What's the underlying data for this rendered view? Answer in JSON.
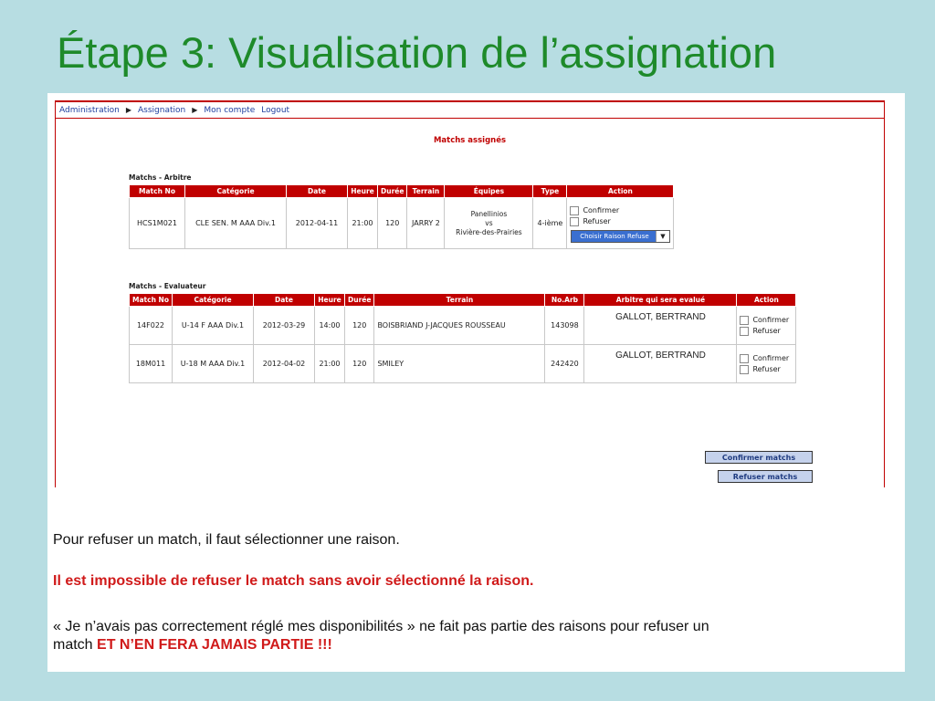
{
  "slide": {
    "title": "Étape 3: Visualisation de l’assignation"
  },
  "nav": {
    "items": [
      "Administration",
      "Assignation",
      "Mon compte",
      "Logout"
    ]
  },
  "section_header": "Matchs assignés",
  "arbitre_table": {
    "caption": "Matchs - Arbitre",
    "headers": [
      "Match No",
      "Catégorie",
      "Date",
      "Heure",
      "Durée",
      "Terrain",
      "Équipes",
      "Type",
      "Action"
    ],
    "rows": [
      {
        "match_no": "HCS1M021",
        "categorie": "CLE SEN. M AAA Div.1",
        "date": "2012-04-11",
        "heure": "21:00",
        "duree": "120",
        "terrain": "JARRY 2",
        "equipe1": "Panellinios",
        "vs": "vs",
        "equipe2": "Rivière-des-Prairies",
        "type": "4-ième",
        "confirmer": "Confirmer",
        "refuser": "Refuser",
        "raison_select": "Choisir Raison Refuse"
      }
    ]
  },
  "evaluateur_table": {
    "caption": "Matchs - Evaluateur",
    "headers": [
      "Match No",
      "Catégorie",
      "Date",
      "Heure",
      "Durée",
      "Terrain",
      "No.Arb",
      "Arbitre qui sera evalué",
      "Action"
    ],
    "rows": [
      {
        "match_no": "14F022",
        "categorie": "U-14 F AAA Div.1",
        "date": "2012-03-29",
        "heure": "14:00",
        "duree": "120",
        "terrain": "BOISBRIAND J-JACQUES ROUSSEAU",
        "no_arb": "143098",
        "arbitre": "GALLOT, BERTRAND",
        "confirmer": "Confirmer",
        "refuser": "Refuser"
      },
      {
        "match_no": "18M011",
        "categorie": "U-18 M AAA Div.1",
        "date": "2012-04-02",
        "heure": "21:00",
        "duree": "120",
        "terrain": "SMILEY",
        "no_arb": "242420",
        "arbitre": "GALLOT, BERTRAND",
        "confirmer": "Confirmer",
        "refuser": "Refuser"
      }
    ]
  },
  "buttons": {
    "confirm": "Confirmer matchs",
    "refuse": "Refuser matchs"
  },
  "notes": {
    "line1": "Pour refuser un match, il faut sélectionner une raison.",
    "line2": "Il est impossible de refuser le match sans avoir sélectionné la raison.",
    "line3a": "« Je n’avais pas correctement réglé mes disponibilités » ne fait pas partie des raisons pour refuser un",
    "line3b": "match ",
    "line3c": "ET N’EN FERA JAMAIS PARTIE !!!"
  }
}
